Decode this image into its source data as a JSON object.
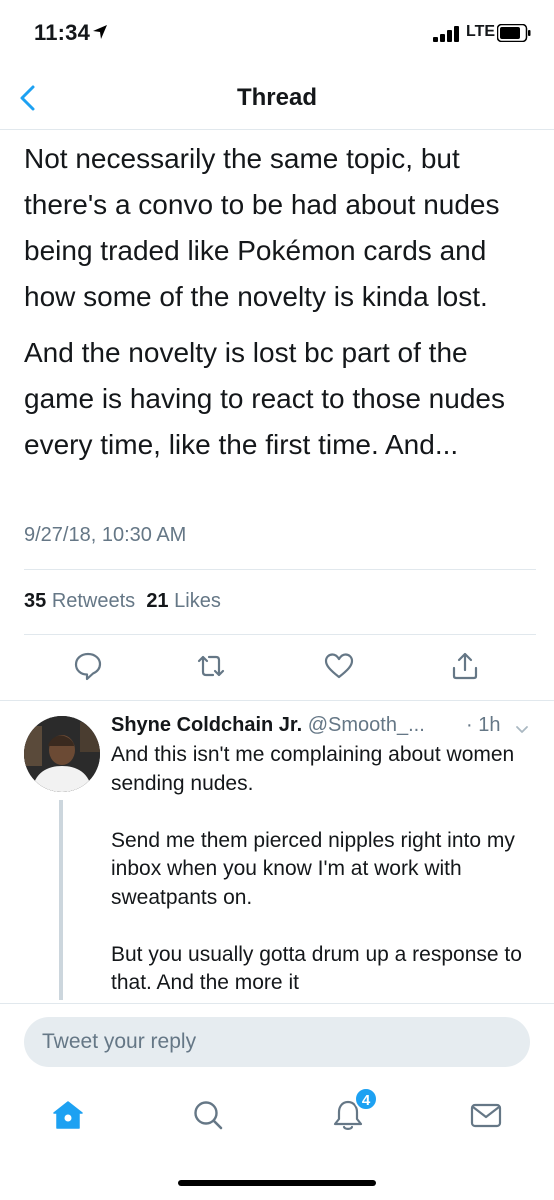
{
  "status_bar": {
    "time": "11:34",
    "network": "LTE"
  },
  "nav": {
    "title": "Thread"
  },
  "tweet": {
    "paragraphs": [
      "Not necessarily the same topic, but there's a convo to be had about nudes being traded like Pokémon cards and how some of the novelty is kinda lost.",
      "And the novelty is lost bc part of the game is having to react to those nudes every time, like the first time. And..."
    ],
    "timestamp": "9/27/18, 10:30 AM",
    "retweets_count": "35",
    "retweets_label": "Retweets",
    "likes_count": "21",
    "likes_label": "Likes"
  },
  "reply": {
    "name": "Shyne Coldchain Jr.",
    "handle": "@Smooth_...",
    "time": "· 1h",
    "paragraphs": [
      "And this isn't me complaining about women sending nudes.",
      "Send me them pierced nipples right into my inbox when you know I'm at work with sweatpants on.",
      "But you usually gotta drum up a response to that. And the more it"
    ]
  },
  "composer": {
    "placeholder": "Tweet your reply"
  },
  "tab_bar": {
    "notifications_badge": "4"
  },
  "colors": {
    "accent": "#1da1f2",
    "text": "#14171a",
    "secondary": "#657786",
    "divider": "#e1e8ed"
  },
  "icons": [
    "location-arrow-icon",
    "signal-icon",
    "battery-icon",
    "back-chevron-icon",
    "reply-icon",
    "retweet-icon",
    "like-icon",
    "share-icon",
    "chevron-down-icon",
    "home-icon",
    "search-icon",
    "notifications-icon",
    "messages-icon"
  ]
}
